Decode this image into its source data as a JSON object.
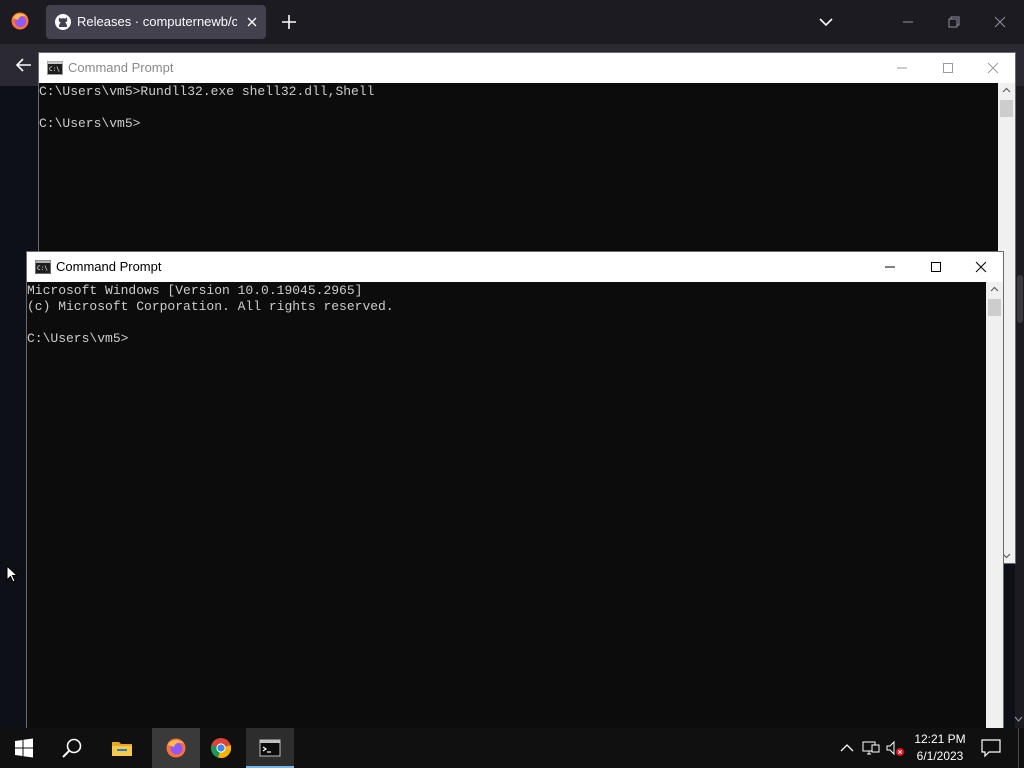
{
  "browser": {
    "tab_title": "Releases · computernewb/colla",
    "accent": "#42414d"
  },
  "back_window": {
    "title": "Command Prompt",
    "lines": [
      "C:\\Users\\vm5>Rundll32.exe shell32.dll,Shell",
      "",
      "C:\\Users\\vm5>"
    ]
  },
  "front_window": {
    "title": "Command Prompt",
    "lines": [
      "Microsoft Windows [Version 10.0.19045.2965]",
      "(c) Microsoft Corporation. All rights reserved.",
      "",
      "C:\\Users\\vm5>"
    ]
  },
  "taskbar": {
    "items": [
      "start-button",
      "search-icon",
      "file-explorer-icon",
      "firefox-icon",
      "chrome-icon",
      "command-prompt-icon"
    ],
    "time": "12:21 PM",
    "date": "6/1/2023",
    "accent": "#76b9ed"
  }
}
